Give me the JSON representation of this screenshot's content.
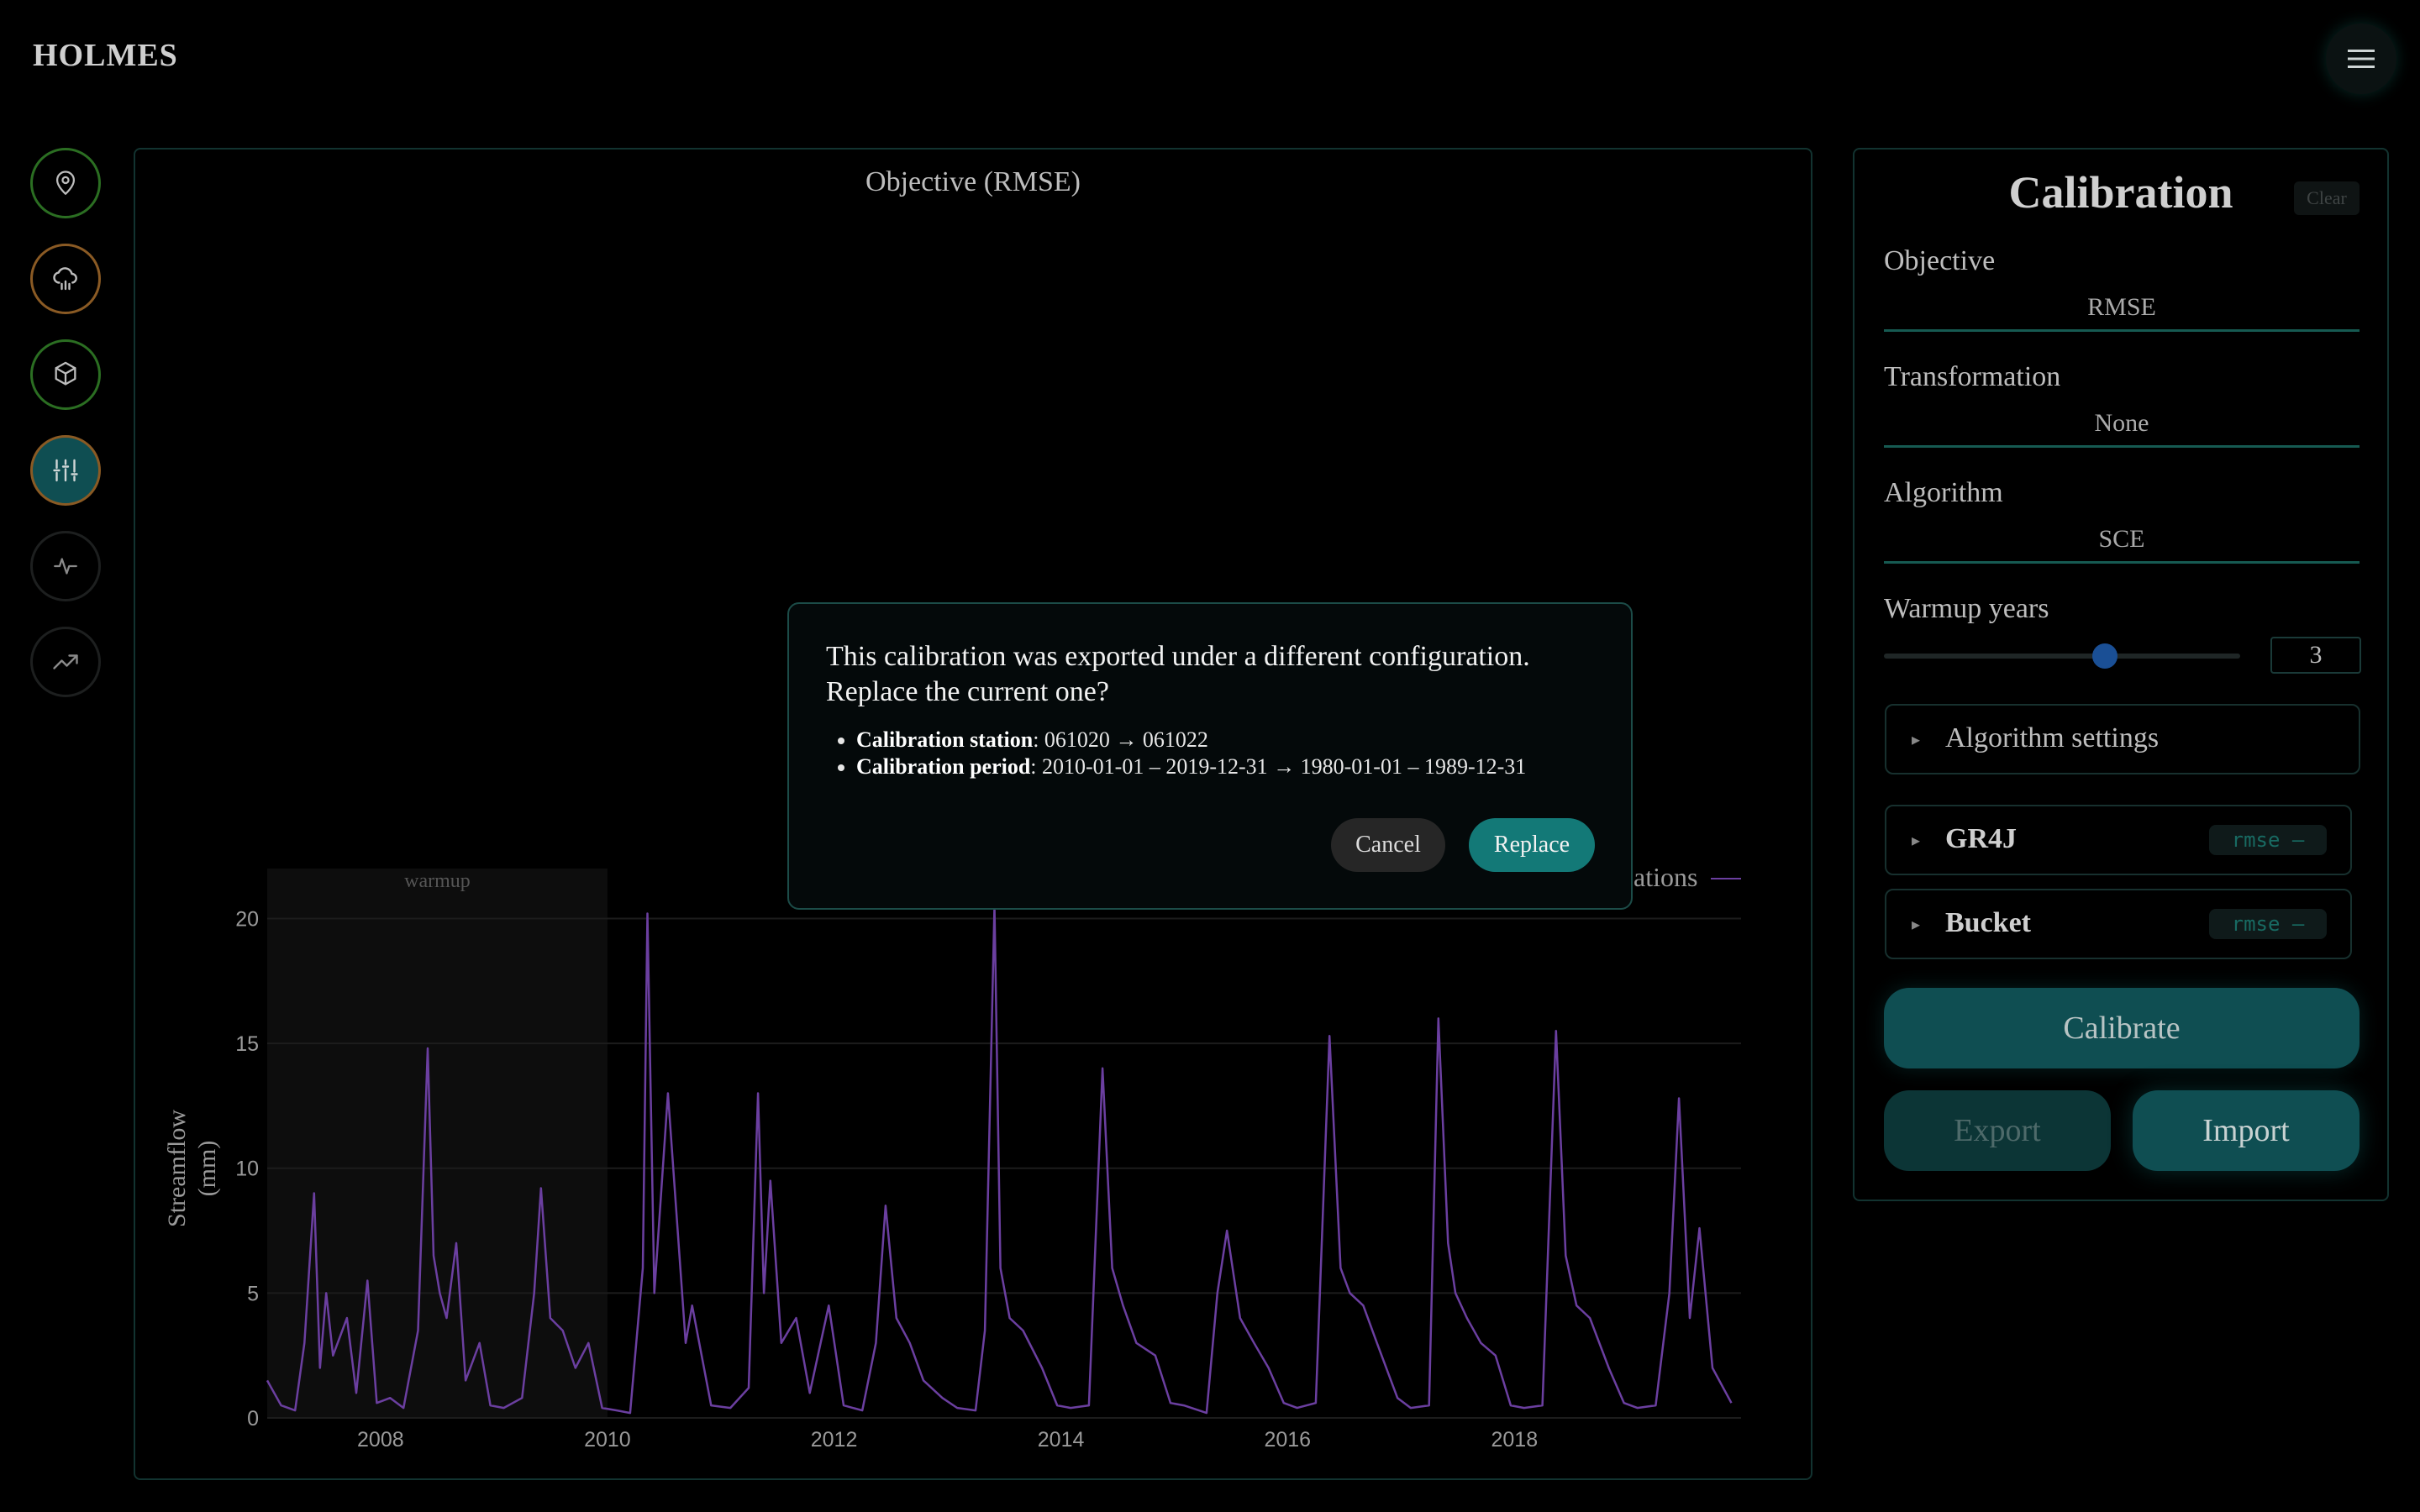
{
  "app": {
    "brand": "HOLMES"
  },
  "icons": {
    "menu": "hamburger-icon",
    "nav": [
      "map-pin-icon",
      "cloud-rain-icon",
      "cube-icon",
      "sliders-icon",
      "pulse-icon",
      "trending-up-icon"
    ]
  },
  "objective_chart": {
    "title": "Objective (RMSE)"
  },
  "calibration": {
    "title": "Calibration",
    "clear_label": "Clear",
    "objective": {
      "label": "Objective",
      "value": "RMSE"
    },
    "transformation": {
      "label": "Transformation",
      "value": "None"
    },
    "algorithm": {
      "label": "Algorithm",
      "value": "SCE"
    },
    "warmup": {
      "label": "Warmup years",
      "value": "3",
      "slider_fraction": 0.62
    },
    "algorithm_settings_label": "Algorithm settings",
    "models": [
      {
        "name": "GR4J",
        "tag": "rmse —"
      },
      {
        "name": "Bucket",
        "tag": "rmse —"
      }
    ],
    "calibrate_label": "Calibrate",
    "export_label": "Export",
    "import_label": "Import"
  },
  "dialog": {
    "message": "This calibration was exported under a different configuration. Replace the current one?",
    "changes": [
      {
        "key": "Calibration station",
        "value": ": 061020 → 061022"
      },
      {
        "key": "Calibration period",
        "value": ": 2010-01-01 – 2019-12-31 → 1980-01-01 – 1989-12-31"
      }
    ],
    "cancel_label": "Cancel",
    "replace_label": "Replace"
  },
  "legend_fragment": "ations",
  "chart_data": {
    "type": "line",
    "ylabel": "Streamflow (mm)",
    "ylim": [
      0,
      22
    ],
    "yticks": [
      0,
      5,
      10,
      15,
      20
    ],
    "xticks": [
      "2008",
      "2010",
      "2012",
      "2014",
      "2016",
      "2018"
    ],
    "xlim": [
      "2007-01-01",
      "2020-01-01"
    ],
    "warmup": {
      "label": "warmup",
      "start": "2007-01-01",
      "end": "2010-01-01"
    },
    "series_color": "#6b3fa0",
    "series": [
      {
        "name": "",
        "x": [
          "2007-01-01",
          "2007-02-15",
          "2007-04-01",
          "2007-05-01",
          "2007-06-01",
          "2007-06-20",
          "2007-07-10",
          "2007-08-01",
          "2007-09-15",
          "2007-10-15",
          "2007-11-20",
          "2007-12-20",
          "2008-02-01",
          "2008-03-15",
          "2008-05-01",
          "2008-06-01",
          "2008-06-20",
          "2008-07-10",
          "2008-08-01",
          "2008-09-01",
          "2008-10-01",
          "2008-11-15",
          "2008-12-20",
          "2009-02-01",
          "2009-04-01",
          "2009-05-10",
          "2009-06-01",
          "2009-07-01",
          "2009-08-10",
          "2009-09-20",
          "2009-11-01",
          "2009-12-15",
          "2010-02-01",
          "2010-03-15",
          "2010-04-25",
          "2010-05-10",
          "2010-06-01",
          "2010-07-15",
          "2010-09-10",
          "2010-10-01",
          "2010-12-01",
          "2011-02-01",
          "2011-04-01",
          "2011-05-01",
          "2011-05-20",
          "2011-06-10",
          "2011-07-15",
          "2011-09-01",
          "2011-10-15",
          "2011-12-15",
          "2012-02-01",
          "2012-04-01",
          "2012-05-15",
          "2012-06-15",
          "2012-07-20",
          "2012-09-01",
          "2012-10-15",
          "2012-12-15",
          "2013-02-01",
          "2013-04-01",
          "2013-05-01",
          "2013-06-01",
          "2013-06-20",
          "2013-07-20",
          "2013-09-01",
          "2013-11-01",
          "2013-12-20",
          "2014-02-01",
          "2014-04-01",
          "2014-05-15",
          "2014-06-15",
          "2014-07-20",
          "2014-09-01",
          "2014-11-01",
          "2014-12-20",
          "2015-02-01",
          "2015-04-15",
          "2015-05-20",
          "2015-06-20",
          "2015-08-01",
          "2015-09-15",
          "2015-11-01",
          "2015-12-20",
          "2016-02-01",
          "2016-04-01",
          "2016-05-15",
          "2016-06-20",
          "2016-07-20",
          "2016-09-01",
          "2016-10-15",
          "2016-12-20",
          "2017-02-01",
          "2017-04-01",
          "2017-05-01",
          "2017-06-01",
          "2017-06-25",
          "2017-08-01",
          "2017-09-15",
          "2017-11-01",
          "2017-12-20",
          "2018-02-01",
          "2018-04-01",
          "2018-05-15",
          "2018-06-15",
          "2018-07-20",
          "2018-09-01",
          "2018-11-01",
          "2018-12-20",
          "2019-02-01",
          "2019-04-01",
          "2019-05-15",
          "2019-06-15",
          "2019-07-20",
          "2019-08-20",
          "2019-10-01",
          "2019-12-01"
        ],
        "y": [
          1.5,
          0.5,
          0.3,
          3.0,
          9.0,
          2.0,
          5.0,
          2.5,
          4.0,
          1.0,
          5.5,
          0.6,
          0.8,
          0.4,
          3.5,
          14.8,
          6.5,
          5.0,
          4.0,
          7.0,
          1.5,
          3.0,
          0.5,
          0.4,
          0.8,
          5.0,
          9.2,
          4.0,
          3.5,
          2.0,
          3.0,
          0.4,
          0.3,
          0.2,
          6.0,
          20.2,
          5.0,
          13.0,
          3.0,
          4.5,
          0.5,
          0.4,
          1.2,
          13.0,
          5.0,
          9.5,
          3.0,
          4.0,
          1.0,
          4.5,
          0.5,
          0.3,
          3.0,
          8.5,
          4.0,
          3.0,
          1.5,
          0.8,
          0.4,
          0.3,
          3.5,
          20.5,
          6.0,
          4.0,
          3.5,
          2.0,
          0.5,
          0.4,
          0.5,
          14.0,
          6.0,
          4.5,
          3.0,
          2.5,
          0.6,
          0.5,
          0.2,
          5.0,
          7.5,
          4.0,
          3.0,
          2.0,
          0.6,
          0.4,
          0.6,
          15.3,
          6.0,
          5.0,
          4.5,
          3.0,
          0.8,
          0.4,
          0.5,
          16.0,
          7.0,
          5.0,
          4.0,
          3.0,
          2.5,
          0.5,
          0.4,
          0.5,
          15.5,
          6.5,
          4.5,
          4.0,
          2.0,
          0.6,
          0.4,
          0.5,
          5.0,
          12.8,
          4.0,
          7.6,
          2.0,
          0.6
        ]
      }
    ]
  }
}
